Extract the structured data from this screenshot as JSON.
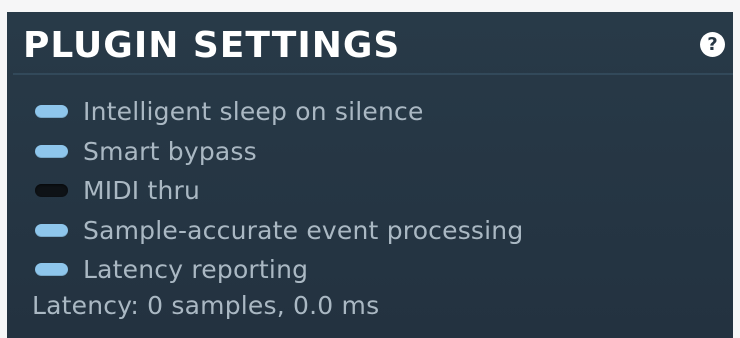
{
  "panel": {
    "title": "PLUGIN SETTINGS",
    "help_icon": "question-mark-icon",
    "help_glyph": "?"
  },
  "options": [
    {
      "label": "Intelligent sleep on silence",
      "enabled": true
    },
    {
      "label": "Smart bypass",
      "enabled": true
    },
    {
      "label": "MIDI thru",
      "enabled": false
    },
    {
      "label": "Sample-accurate event processing",
      "enabled": true
    },
    {
      "label": "Latency reporting",
      "enabled": true
    }
  ],
  "status": {
    "latency_text": "Latency: 0 samples, 0.0 ms"
  },
  "colors": {
    "panel_background": "#263644",
    "toggle_on": "#8ec6ec",
    "toggle_off": "#0e1216",
    "text": "#aab8c3",
    "title": "#ffffff"
  }
}
